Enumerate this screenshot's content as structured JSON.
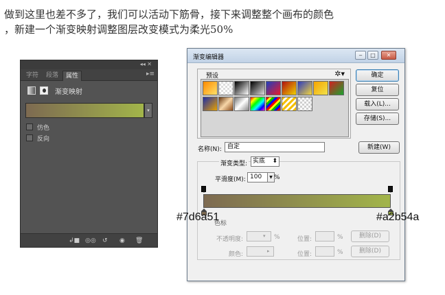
{
  "article": {
    "line1": "做到这里也差不多了，我们可以活动下筋骨，接下来调整整个画布的颜色",
    "line2": "，新建一个渐变映射调整图层改变模式为柔光50%"
  },
  "panel": {
    "tabs": [
      "字符",
      "段落",
      "属性"
    ],
    "active_tab": "属性",
    "title": "渐变映射",
    "gradient_colors": [
      "#7d6a51",
      "#a2b54a"
    ],
    "options": [
      {
        "label": "仿色",
        "checked": false
      },
      {
        "label": "反向",
        "checked": false
      }
    ],
    "icons": [
      "adjustment-icon",
      "mask-icon",
      "clip-icon",
      "view-previous-icon",
      "reset-icon",
      "visibility-icon",
      "trash-icon"
    ]
  },
  "dialog": {
    "title": "渐变编辑器",
    "presets_label": "预设",
    "buttons": {
      "ok": "确定",
      "reset": "复位",
      "load": "载入(L)...",
      "save": "存储(S)...",
      "new": "新建(W)"
    },
    "name_label": "名称(N):",
    "name_value": "自定",
    "gradient_type_label": "渐变类型:",
    "gradient_type_value": "实底",
    "smoothness_label": "平滑度(M):",
    "smoothness_value": "100",
    "smoothness_unit": "%",
    "stops_label": "色标",
    "opacity_label": "不透明度:",
    "position_label": "位置:",
    "color_label": "颜色:",
    "delete_label": "删除(D)",
    "percent": "%",
    "gradient_colors": [
      "#7d6a51",
      "#a2b54a"
    ],
    "left_color_hex": "#7d6a51",
    "right_color_hex": "#a2b54a"
  }
}
